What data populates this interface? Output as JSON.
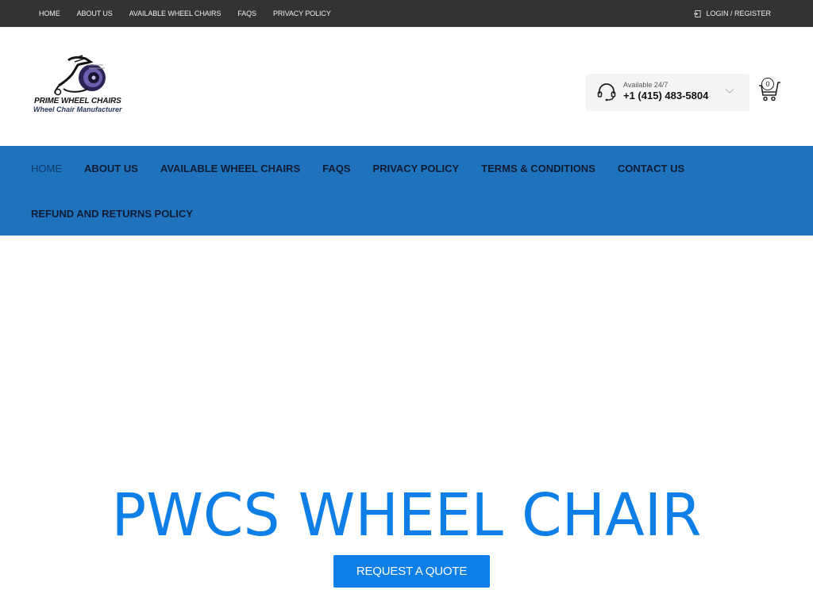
{
  "topbar": {
    "links": [
      {
        "label": "HOME"
      },
      {
        "label": "ABOUT US"
      },
      {
        "label": "AVAILABLE WHEEL CHAIRS"
      },
      {
        "label": "FAQS"
      },
      {
        "label": "PRIVACY POLICY"
      }
    ],
    "login": {
      "label": "LOGIN / REGISTER",
      "icon": "login-icon"
    }
  },
  "header": {
    "logo": {
      "brand": "PRIME WHEEL CHAIRS",
      "tagline": "Wheel Chair Manufacturer"
    },
    "contact": {
      "availability": "Available 24/7",
      "phone": "+1 (415) 483-5804",
      "icon": "headset-icon"
    },
    "cart": {
      "count": "0",
      "icon": "cart-icon"
    }
  },
  "mainnav": {
    "items": [
      {
        "label": "HOME",
        "active": true
      },
      {
        "label": "ABOUT US"
      },
      {
        "label": "AVAILABLE WHEEL CHAIRS"
      },
      {
        "label": "FAQS"
      },
      {
        "label": "PRIVACY POLICY"
      },
      {
        "label": "TERMS & CONDITIONS"
      },
      {
        "label": "CONTACT US"
      },
      {
        "label": "REFUND AND RETURNS POLICY"
      }
    ]
  },
  "hero": {
    "title": "PWCS WHEEL CHAIR",
    "cta_label": "REQUEST A QUOTE"
  },
  "colors": {
    "topbar": "#333333",
    "nav": "#1f72bc",
    "accent": "#0d7fe6"
  }
}
